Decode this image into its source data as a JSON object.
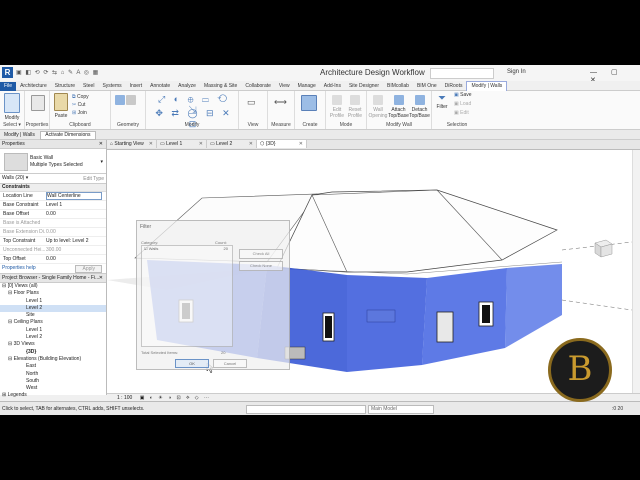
{
  "app": {
    "title": "Architecture Design Workflow",
    "logo": "R",
    "quick_access": "▣ ◧ ⟲ ⟳ ⇆ ⌂ ✎ A ◎ ▦",
    "sign_in": "Sign In",
    "window_buttons": "— ▢ ✕"
  },
  "ribbon_tabs": [
    "File",
    "Architecture",
    "Structure",
    "Steel",
    "Systems",
    "Insert",
    "Annotate",
    "Analyze",
    "Massing & Site",
    "Collaborate",
    "View",
    "Manage",
    "Add-Ins",
    "Site Designer",
    "BIMcollab",
    "BIM One",
    "DiRoots",
    "Modify | Walls"
  ],
  "ribbon": {
    "select": {
      "modify": "Modify",
      "label": "Select ▾"
    },
    "properties": {
      "label": "Properties"
    },
    "clipboard": {
      "paste": "Paste",
      "copy": "Copy",
      "cut": "Cut",
      "join": "Join",
      "label": "Clipboard"
    },
    "geometry": {
      "label": "Geometry"
    },
    "modify": {
      "label": "Modify"
    },
    "view": {
      "label": "View"
    },
    "measure": {
      "label": "Measure"
    },
    "create": {
      "label": "Create"
    },
    "mode": {
      "edit_profile": "Edit Profile",
      "reset_profile": "Reset Profile",
      "label": "Mode"
    },
    "modify_wall": {
      "wall_openings": "Wall Opening",
      "attach": "Attach Top/Base",
      "detach": "Detach Top/Base",
      "label": "Modify Wall"
    },
    "selection": {
      "filter": "Filter",
      "save": "Save",
      "load": "Load",
      "edit": "Edit",
      "label": "Selection"
    }
  },
  "options_bar": {
    "context": "Modify | Walls",
    "activate_dimensions": "Activate Dimensions"
  },
  "properties": {
    "header": "Properties",
    "type_line1": "Basic Wall",
    "type_line2": "Multiple Types Selected",
    "instances": "Walls (20)",
    "edit_type": "Edit Type",
    "section": "Constraints",
    "rows": [
      {
        "k": "Location Line",
        "v": "Wall Centerline"
      },
      {
        "k": "Base Constraint",
        "v": "Level 1"
      },
      {
        "k": "Base Offset",
        "v": "0.00"
      },
      {
        "k": "Base is Attached",
        "v": ""
      },
      {
        "k": "Base Extension Di...",
        "v": "0.00"
      },
      {
        "k": "Top Constraint",
        "v": "Up to level: Level 2"
      },
      {
        "k": "Unconnected Hei...",
        "v": "300.00"
      },
      {
        "k": "Top Offset",
        "v": "0.00"
      }
    ],
    "help": "Properties help",
    "apply": "Apply"
  },
  "project_browser": {
    "header": "Project Browser - Single Family Home - Fi...",
    "nodes": [
      {
        "t": "⊟ [0] Views (all)",
        "ind": 2
      },
      {
        "t": "⊟ Floor Plans",
        "ind": 8
      },
      {
        "t": "Level 1",
        "ind": 26
      },
      {
        "t": "Level 2",
        "ind": 26
      },
      {
        "t": "Site",
        "ind": 26
      },
      {
        "t": "⊟ Ceiling Plans",
        "ind": 8
      },
      {
        "t": "Level 1",
        "ind": 26
      },
      {
        "t": "Level 2",
        "ind": 26
      },
      {
        "t": "⊟ 3D Views",
        "ind": 8
      },
      {
        "t": "{3D}",
        "ind": 26
      },
      {
        "t": "⊟ Elevations (Building Elevation)",
        "ind": 8
      },
      {
        "t": "East",
        "ind": 26
      },
      {
        "t": "North",
        "ind": 26
      },
      {
        "t": "South",
        "ind": 26
      },
      {
        "t": "West",
        "ind": 26
      },
      {
        "t": "⊞ Legends",
        "ind": 2
      }
    ]
  },
  "doc_tabs": [
    {
      "label": "Starting View",
      "close": "✕"
    },
    {
      "label": "Level 1",
      "close": "✕"
    },
    {
      "label": "Level 2",
      "close": "✕"
    },
    {
      "label": "{3D}",
      "close": "✕"
    }
  ],
  "filter_dialog": {
    "title": "Filter",
    "category": "Category:",
    "count": "Count:",
    "row_label": "Walls",
    "row_count": "20",
    "check_all": "Check All",
    "check_none": "Check None",
    "total": "Total Selected Items:",
    "total_value": "20",
    "ok": "OK",
    "cancel": "Cancel"
  },
  "view_bar": {
    "scale": "1 : 100",
    "icons": "▣ ◐ ☀ ◑ ⊡ ⟡ ◇ ⋯"
  },
  "status": {
    "message": "Click to select, TAB for alternates, CTRL adds, SHIFT unselects.",
    "model": "Main Model",
    "select_count": ":0 20"
  },
  "colors": {
    "accent": "#1f5aa6",
    "wall_select": "#3a5de0"
  }
}
